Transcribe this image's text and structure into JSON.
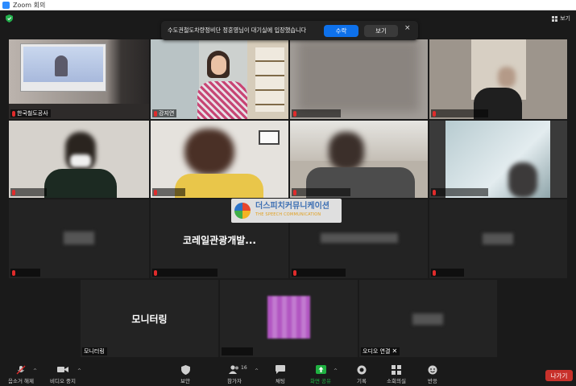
{
  "window": {
    "title": "Zoom 회의"
  },
  "view_button": {
    "label": "보기"
  },
  "notification": {
    "text": "수도권철도차량정비단 정훈영님이 대기실에 입장했습니다",
    "accept_label": "수락",
    "view_label": "보기",
    "close_label": "×"
  },
  "tiles": [
    {
      "name": "한국철도공사",
      "muted": true
    },
    {
      "name": "강지연",
      "muted": true
    },
    {
      "name": "",
      "muted": true
    },
    {
      "name": "",
      "muted": true
    },
    {
      "name": "",
      "muted": true
    },
    {
      "name": "",
      "muted": true
    },
    {
      "name": "",
      "muted": true
    },
    {
      "name": "",
      "muted": true
    },
    {
      "name": "",
      "muted": true
    },
    {
      "name": "",
      "center_label": "코레일관광개발...",
      "muted": true
    },
    {
      "name": "",
      "muted": true
    },
    {
      "name": "",
      "muted": true
    },
    {
      "name": "모니터링",
      "center_label": "모니터링",
      "muted": false
    },
    {
      "name": "",
      "muted": false
    },
    {
      "name": "오디오 연결",
      "muted": false
    }
  ],
  "watermark": {
    "title": "더스피치커뮤니케이션",
    "subtitle": "THE SPEECH COMMUNICATION"
  },
  "toolbar": {
    "mute": "음소거 해제",
    "video": "비디오 중지",
    "security": "보안",
    "participants": "참가자",
    "participants_count": "16",
    "chat": "채팅",
    "share": "화면 공유",
    "record": "기록",
    "breakout": "소회의실",
    "reactions": "반응",
    "leave": "나가기"
  },
  "colors": {
    "accent": "#0e71eb",
    "leave": "#c8312b",
    "active_speaker": "#c9e36a",
    "share_green": "#1fb141"
  }
}
